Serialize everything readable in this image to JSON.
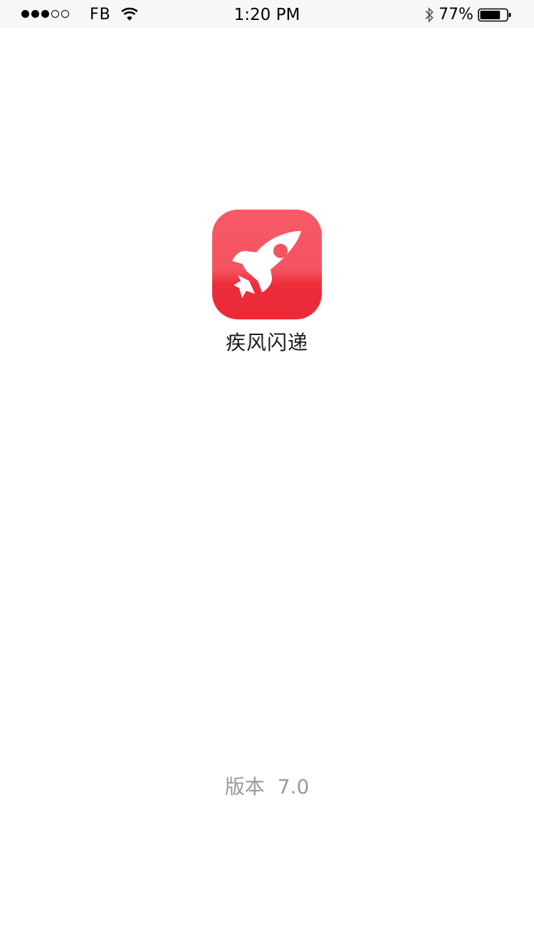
{
  "status_bar": {
    "signal_filled": 3,
    "signal_total": 5,
    "carrier": "FB",
    "wifi_icon": "wifi-icon",
    "time": "1:20 PM",
    "bluetooth_icon": "bluetooth-icon",
    "battery_percent": "77%",
    "battery_level": 0.77,
    "battery_icon": "battery-icon"
  },
  "splash": {
    "app_icon": "rocket-icon",
    "app_icon_colors": {
      "top": "#f75a67",
      "bottom": "#ea2a36",
      "glyph": "#ffffff"
    },
    "app_name": "疾风闪递",
    "version_label": "版本",
    "version_number": "7.0"
  }
}
